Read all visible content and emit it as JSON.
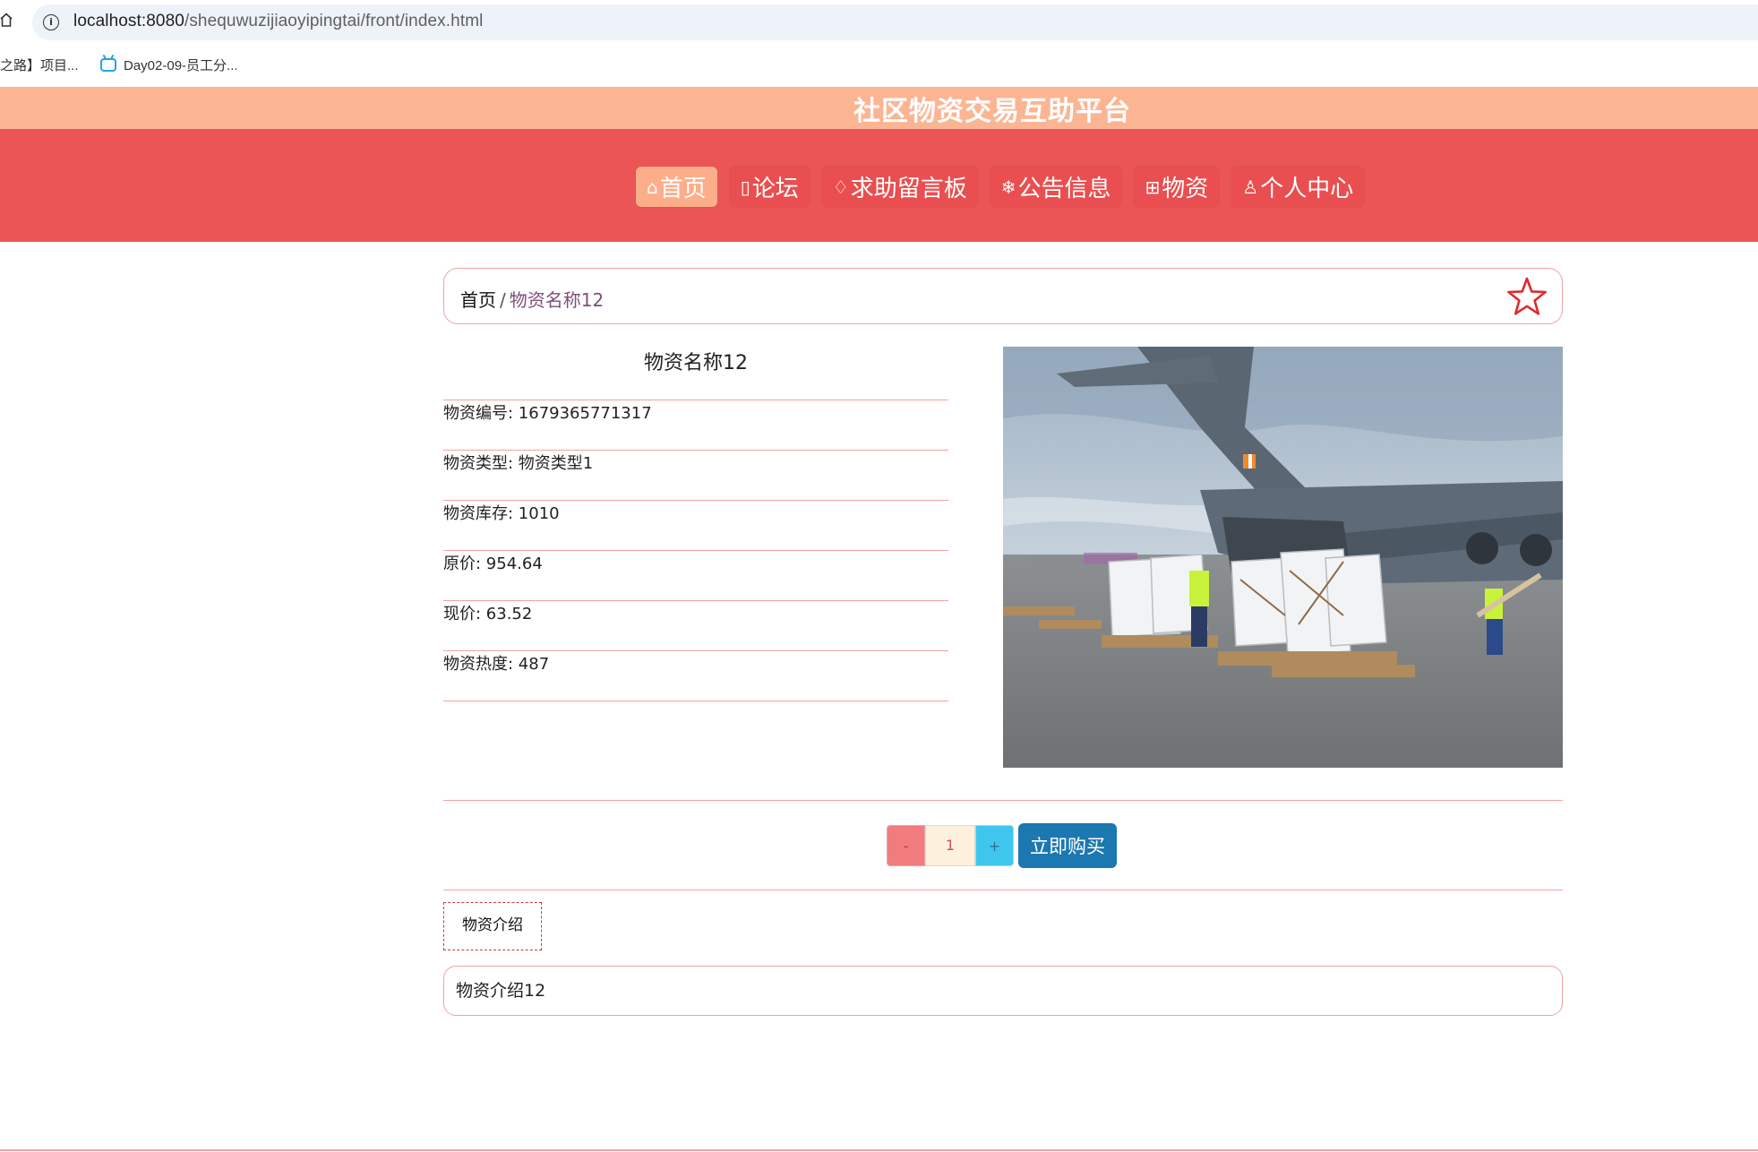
{
  "browser": {
    "url_host": "localhost:8080",
    "url_path": "/shequwuzijiaoyipingtai/front/index.html",
    "bookmarks": [
      {
        "label": "之路】项目..."
      },
      {
        "label": "Day02-09-员工分..."
      }
    ]
  },
  "site": {
    "title": "社区物资交易互助平台",
    "nav": [
      {
        "icon": "⌂",
        "label": "首页",
        "active": true
      },
      {
        "icon": "▯",
        "label": "论坛"
      },
      {
        "icon": "♢",
        "label": "求助留言板"
      },
      {
        "icon": "❄",
        "label": "公告信息"
      },
      {
        "icon": "⊞",
        "label": "物资"
      },
      {
        "icon": "♙",
        "label": "个人中心"
      }
    ]
  },
  "breadcrumb": {
    "home": "首页",
    "separator": "/",
    "current": "物资名称12"
  },
  "item": {
    "name": "物资名称12",
    "fields": [
      {
        "label": "物资编号: 1679365771317"
      },
      {
        "label": "物资类型: 物资类型1"
      },
      {
        "label": "物资库存: 1010"
      },
      {
        "label": "原价: 954.64"
      },
      {
        "label": "现价: 63.52"
      },
      {
        "label": "物资热度: 487"
      }
    ]
  },
  "purchase": {
    "minus": "-",
    "quantity": "1",
    "plus": "+",
    "buy_label": "立即购买"
  },
  "intro": {
    "tab_label": "物资介绍",
    "content": "物资介绍12"
  },
  "colors": {
    "title_bar": "#fcb592",
    "nav_bar": "#eb5556",
    "nav_active": "#fcae8a",
    "border_pink": "#f1a3a3",
    "buy_button": "#1b78b0",
    "star": "#e02a2a"
  }
}
